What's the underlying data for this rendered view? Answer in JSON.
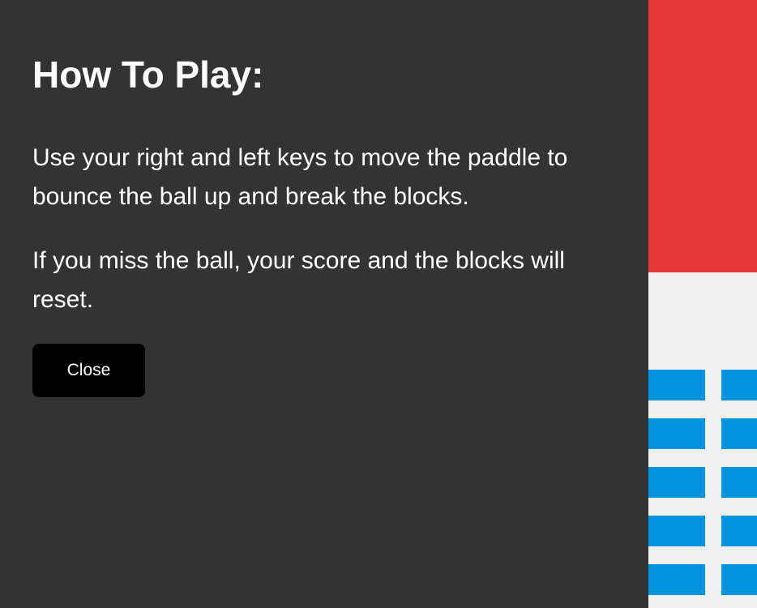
{
  "rules": {
    "title": "How To Play:",
    "paragraph1": "Use your right and left keys to move the paddle to bounce the ball up and break the blocks.",
    "paragraph2": "If you miss the ball, your score and the blocks will reset.",
    "close_label": "Close"
  },
  "colors": {
    "panel_background": "#333333",
    "header_red": "#e73b3b",
    "brick_blue": "#0095dd",
    "canvas_background": "#f0f0f0",
    "close_button": "#000000"
  }
}
